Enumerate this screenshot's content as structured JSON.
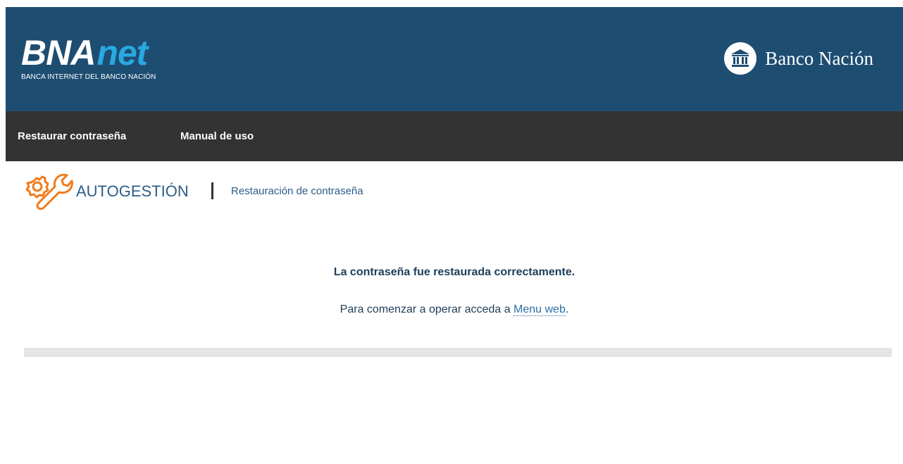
{
  "colors": {
    "header_bg": "#1e4d72",
    "navbar_bg": "#333333",
    "accent_orange": "#f07a1b",
    "link_blue": "#2c6fa3",
    "title_blue": "#2c5d87"
  },
  "header": {
    "logo_bna": "BNA",
    "logo_net": "net",
    "logo_subtitle": "BANCA INTERNET DEL BANCO NACIÓN",
    "bank_name": "Banco Nación",
    "bank_icon": "bank-building-icon"
  },
  "nav": {
    "items": [
      {
        "label": "Restaurar contraseña"
      },
      {
        "label": "Manual de uso"
      }
    ]
  },
  "breadcrumb": {
    "icon": "gear-wrench-icon",
    "section": "AUTOGESTIÓN",
    "page": "Restauración de contraseña"
  },
  "message": {
    "title": "La contraseña fue restaurada correctamente.",
    "body_prefix": "Para comenzar a operar acceda a ",
    "link": "Menu web",
    "body_suffix": "."
  }
}
